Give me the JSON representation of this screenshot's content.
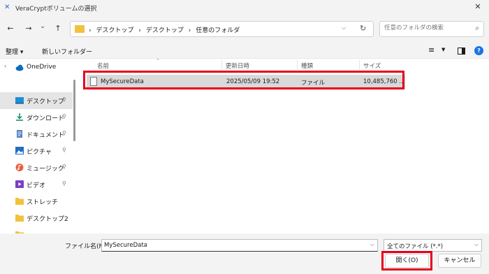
{
  "window": {
    "title": "VeraCryptボリュームの選択",
    "close_glyph": "✕"
  },
  "nav": {
    "back": "←",
    "forward": "→",
    "recent": "⌄",
    "up": "↑"
  },
  "address": {
    "crumbs": [
      "デスクトップ",
      "デスクトップ",
      "任意のフォルダ"
    ],
    "separator": "›"
  },
  "search": {
    "placeholder": "任意のフォルダの検索"
  },
  "toolbar": {
    "organize": "整理 ▾",
    "new_folder": "新しいフォルダー"
  },
  "sidebar": {
    "items": [
      {
        "label": "OneDrive",
        "icon": "cloud-icon",
        "pinned": false,
        "expandable": true
      },
      {
        "label": "デスクトップ",
        "icon": "desktop-icon",
        "pinned": true,
        "selected": true
      },
      {
        "label": "ダウンロード",
        "icon": "download-icon",
        "pinned": true
      },
      {
        "label": "ドキュメント",
        "icon": "document-icon",
        "pinned": true
      },
      {
        "label": "ピクチャ",
        "icon": "pictures-icon",
        "pinned": true
      },
      {
        "label": "ミュージック",
        "icon": "music-icon",
        "pinned": true
      },
      {
        "label": "ビデオ",
        "icon": "video-icon",
        "pinned": true
      },
      {
        "label": "ストレッチ",
        "icon": "folder-icon",
        "pinned": false
      },
      {
        "label": "デスクトップ2",
        "icon": "folder-icon",
        "pinned": false
      }
    ]
  },
  "filelist": {
    "columns": [
      "名前",
      "更新日時",
      "種類",
      "サイズ"
    ],
    "rows": [
      {
        "name": "MySecureData",
        "modified": "2025/05/09 19:52",
        "type": "ファイル",
        "size": "10,485,760 ..."
      }
    ]
  },
  "bottom": {
    "filename_label": "ファイル名(N):",
    "filename_value": "MySecureData",
    "filetype_value": "全てのファイル (*.*)",
    "open_label": "開く(O)",
    "cancel_label": "キャンセル"
  },
  "colors": {
    "highlight": "#e8001c",
    "selected_row": "#d9d9d9",
    "folder": "#f2c23d",
    "help": "#1a73e8"
  }
}
